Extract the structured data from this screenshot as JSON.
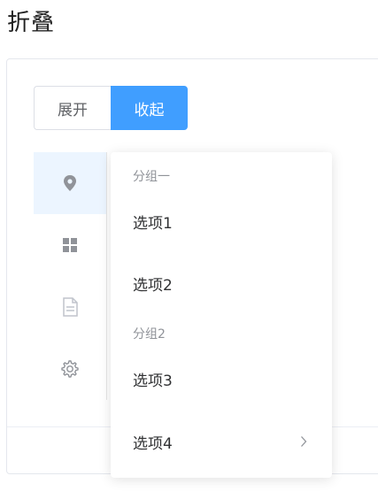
{
  "page": {
    "title": "折叠"
  },
  "toolbar": {
    "expand_label": "展开",
    "collapse_label": "收起"
  },
  "sidebar": {
    "items": [
      {
        "icon": "location-icon",
        "active": true
      },
      {
        "icon": "grid-icon",
        "active": false
      },
      {
        "icon": "document-icon",
        "disabled": true
      },
      {
        "icon": "gear-icon",
        "active": false
      }
    ]
  },
  "popup_menu": {
    "groups": [
      {
        "title": "分组一",
        "options": [
          "选项1",
          "选项2"
        ]
      },
      {
        "title": "分组2",
        "options": [
          "选项3"
        ]
      }
    ],
    "submenu_option": "选项4"
  },
  "colors": {
    "primary": "#409eff",
    "active_bg": "#ecf5ff",
    "icon": "#909399",
    "icon_disabled": "#c0c4cc"
  }
}
